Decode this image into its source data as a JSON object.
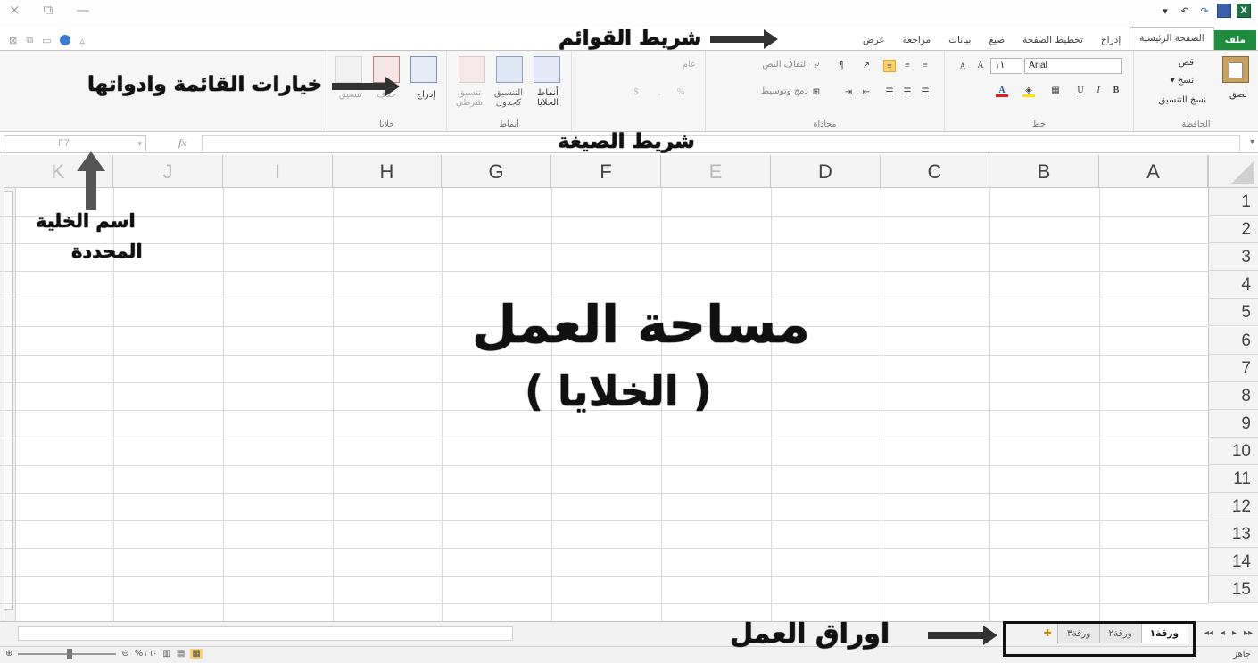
{
  "window": {
    "close_glyph": "×",
    "restore_glyph": "⧉",
    "minimize_glyph": "—"
  },
  "quick_access": {
    "customize": "▾",
    "undo": "↶",
    "redo": "↷"
  },
  "tabs": [
    {
      "label": "ملف",
      "type": "file"
    },
    {
      "label": "الصفحة الرئيسية",
      "type": "active"
    },
    {
      "label": "إدراج",
      "type": "normal"
    },
    {
      "label": "تخطيط الصفحة",
      "type": "normal"
    },
    {
      "label": "صيغ",
      "type": "normal"
    },
    {
      "label": "بيانات",
      "type": "normal"
    },
    {
      "label": "مراجعة",
      "type": "normal"
    },
    {
      "label": "عرض",
      "type": "normal"
    }
  ],
  "ribbon": {
    "clipboard": {
      "label": "الحافظة",
      "paste": "لصق",
      "cut": "قص",
      "copy": "نسخ ▾",
      "format_painter": "نسخ التنسيق"
    },
    "font": {
      "label": "خط",
      "font_name": "Arial",
      "font_size": "١١",
      "bold": "B",
      "italic": "I",
      "underline": "U"
    },
    "alignment": {
      "label": "محاذاة",
      "wrap_text": "التفاف النص",
      "merge_center": "دمج وتوسيط"
    },
    "number": {
      "label": "عام"
    },
    "styles": {
      "label": "أنماط",
      "conditional": "تنسيق شرطي",
      "format_table": "التنسيق كجدول",
      "cell_styles": "أنماط الخلايا"
    },
    "cells": {
      "label": "خلايا",
      "insert": "إدراج",
      "delete": "حذف",
      "format": "تنسيق"
    }
  },
  "formula_bar": {
    "name_box": "F7",
    "fx": "fx"
  },
  "grid": {
    "columns": [
      "A",
      "B",
      "C",
      "D",
      "E",
      "F",
      "G",
      "H",
      "I",
      "J",
      "K"
    ],
    "rows": [
      "1",
      "2",
      "3",
      "4",
      "5",
      "6",
      "7",
      "8",
      "9",
      "10",
      "11",
      "12",
      "13",
      "14",
      "15"
    ]
  },
  "sheets": {
    "tabs": [
      {
        "label": "ورقة١",
        "active": true
      },
      {
        "label": "ورقة٢",
        "active": false
      },
      {
        "label": "ورقة٣",
        "active": false
      }
    ],
    "nav": [
      "◂◂",
      "◂",
      "▸",
      "▸▸"
    ]
  },
  "status": {
    "ready": "جاهز",
    "zoom": "%١٦٠"
  },
  "annotations": {
    "menu_bar": "شريط القوائم",
    "menu_options": "خيارات القائمة وادواتها",
    "formula_bar": "شريط الصيغة",
    "cell_name": "اسم الخلية",
    "cell_name_2": "المحددة",
    "workspace": "مساحة العمل",
    "cells": "( الخلايا )",
    "worksheets": "اوراق العمل"
  }
}
